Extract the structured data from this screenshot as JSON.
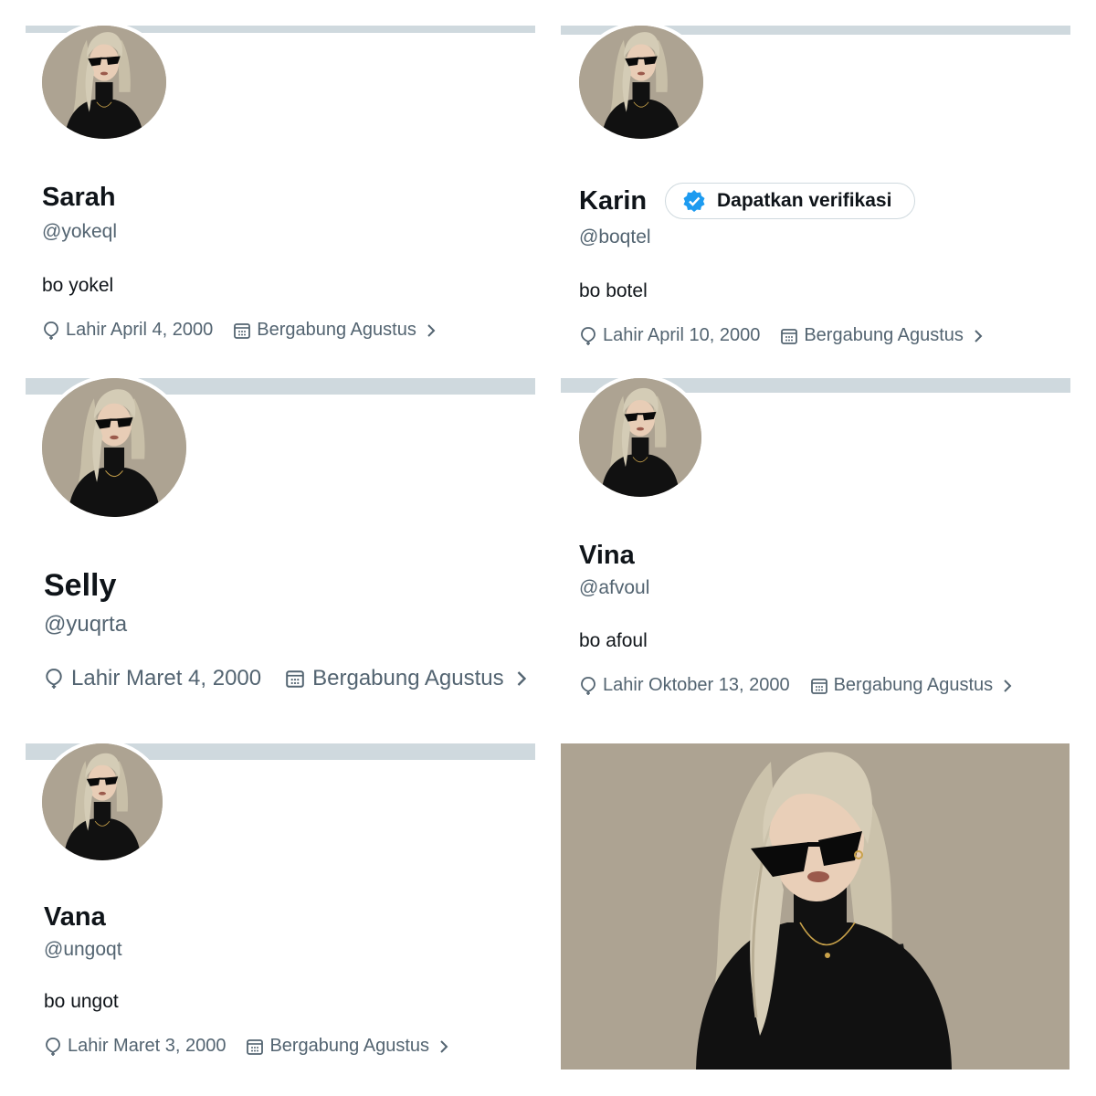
{
  "profiles": {
    "sarah": {
      "name": "Sarah",
      "handle": "@yokeql",
      "bio": "bo yokel",
      "birth": "Lahir April 4, 2000",
      "joined": "Bergabung Agustus"
    },
    "karin": {
      "name": "Karin",
      "handle": "@boqtel",
      "bio": "bo botel",
      "birth": "Lahir April 10, 2000",
      "joined": "Bergabung Agustus",
      "verify_label": "Dapatkan verifikasi"
    },
    "selly": {
      "name": "Selly",
      "handle": "@yuqrta",
      "birth": "Lahir Maret 4, 2000",
      "joined": "Bergabung Agustus"
    },
    "vina": {
      "name": "Vina",
      "handle": "@afvoul",
      "bio": "bo afoul",
      "birth": "Lahir Oktober 13, 2000",
      "joined": "Bergabung Agustus"
    },
    "vana": {
      "name": "Vana",
      "handle": "@ungoqt",
      "bio": "bo ungot",
      "birth": "Lahir Maret 3, 2000",
      "joined": "Bergabung Agustus"
    }
  },
  "icons": {
    "birth": "balloon-icon",
    "joined": "calendar-icon",
    "more": "chevron-right-icon",
    "verified": "verified-badge-icon"
  },
  "colors": {
    "banner": "#cfd9de",
    "text_primary": "#0f1419",
    "text_secondary": "#536471",
    "verified_blue": "#1d9bf0",
    "photo_background": "#ada392"
  }
}
